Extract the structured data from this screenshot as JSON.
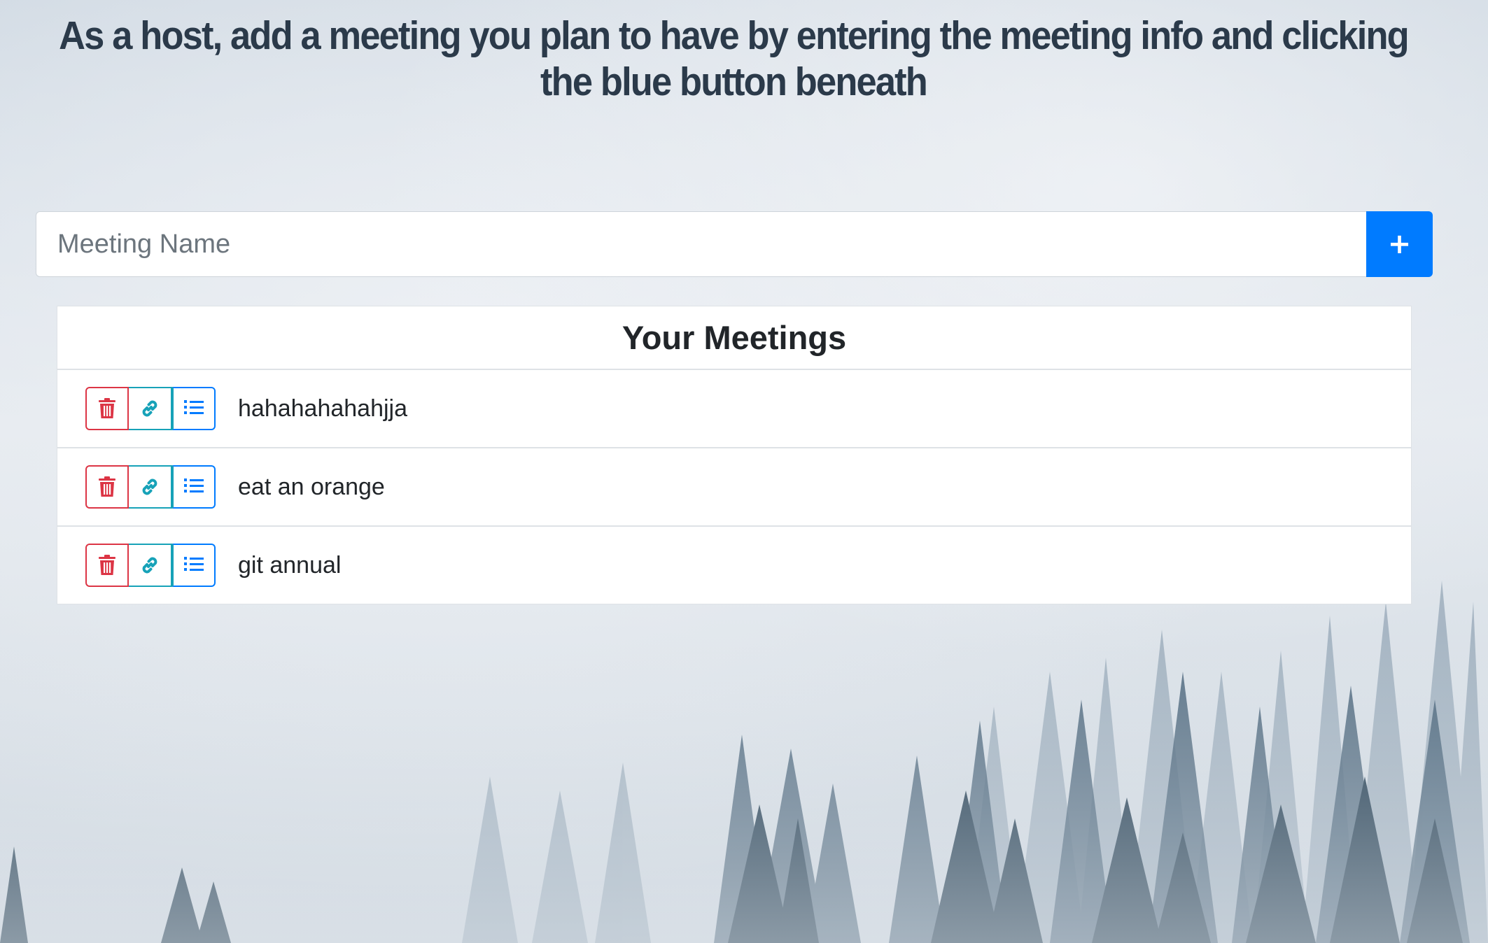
{
  "page": {
    "headline": "As a host, add a meeting you plan to have by entering the meeting info and clicking the blue button beneath"
  },
  "form": {
    "placeholder": "Meeting Name",
    "value": "",
    "add_label": "+"
  },
  "meetings": {
    "title": "Your Meetings",
    "items": [
      {
        "name": "hahahahahahjja"
      },
      {
        "name": "eat an orange"
      },
      {
        "name": "git annual"
      }
    ]
  },
  "icons": {
    "delete": "trash-icon",
    "link": "link-icon",
    "list": "list-icon",
    "add": "plus-icon"
  },
  "colors": {
    "primary": "#007bff",
    "danger": "#dc3545",
    "info": "#17a2b8",
    "headline": "#2b3a4a"
  }
}
